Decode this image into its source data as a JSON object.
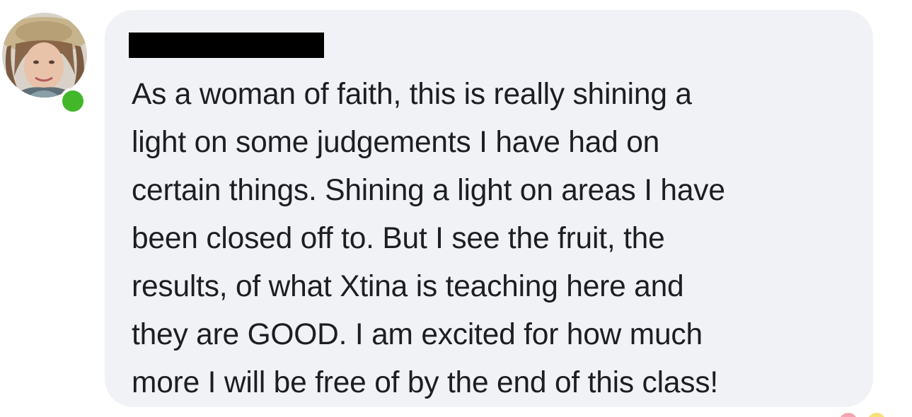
{
  "comment": {
    "author_name": "",
    "author_name_redacted": true,
    "author_online": true,
    "text_lines": [
      "As a woman of faith, this is really shining a",
      "light on some judgements I have had on",
      "certain things. Shining a light on areas I have",
      "been closed off to. But I see the fruit, the",
      "results, of what Xtina is teaching here and",
      "they are GOOD. I am excited for how much",
      "more I will be free of by the end of this class!"
    ]
  },
  "icons": {
    "avatar": "user-profile-photo",
    "presence": "online-status-dot",
    "reactions": [
      "love-reaction-icon",
      "haha-reaction-icon"
    ]
  },
  "colors": {
    "bubble_background": "#f0f2f5",
    "text": "#1c1e21",
    "online_indicator": "#42b72a",
    "redaction_bar": "#000000"
  }
}
